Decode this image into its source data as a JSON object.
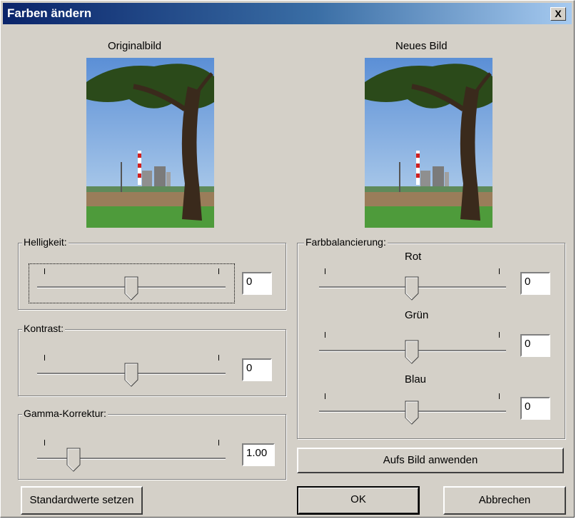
{
  "window": {
    "title": "Farben ändern",
    "close_label": "X"
  },
  "preview": {
    "original_label": "Originalbild",
    "new_label": "Neues Bild"
  },
  "brightness": {
    "label": "Helligkeit:",
    "value": "0",
    "level": 0.5
  },
  "contrast": {
    "label": "Kontrast:",
    "value": "0",
    "level": 0.5
  },
  "gamma": {
    "label": "Gamma-Korrektur:",
    "value": "1.00",
    "level": 0.17
  },
  "color_balance": {
    "label": "Farbbalancierung:",
    "red": {
      "label": "Rot",
      "value": "0",
      "level": 0.5
    },
    "green": {
      "label": "Grün",
      "value": "0",
      "level": 0.5
    },
    "blue": {
      "label": "Blau",
      "value": "0",
      "level": 0.5
    }
  },
  "buttons": {
    "apply": "Aufs Bild anwenden",
    "defaults": "Standardwerte setzen",
    "ok": "OK",
    "cancel": "Abbrechen"
  }
}
